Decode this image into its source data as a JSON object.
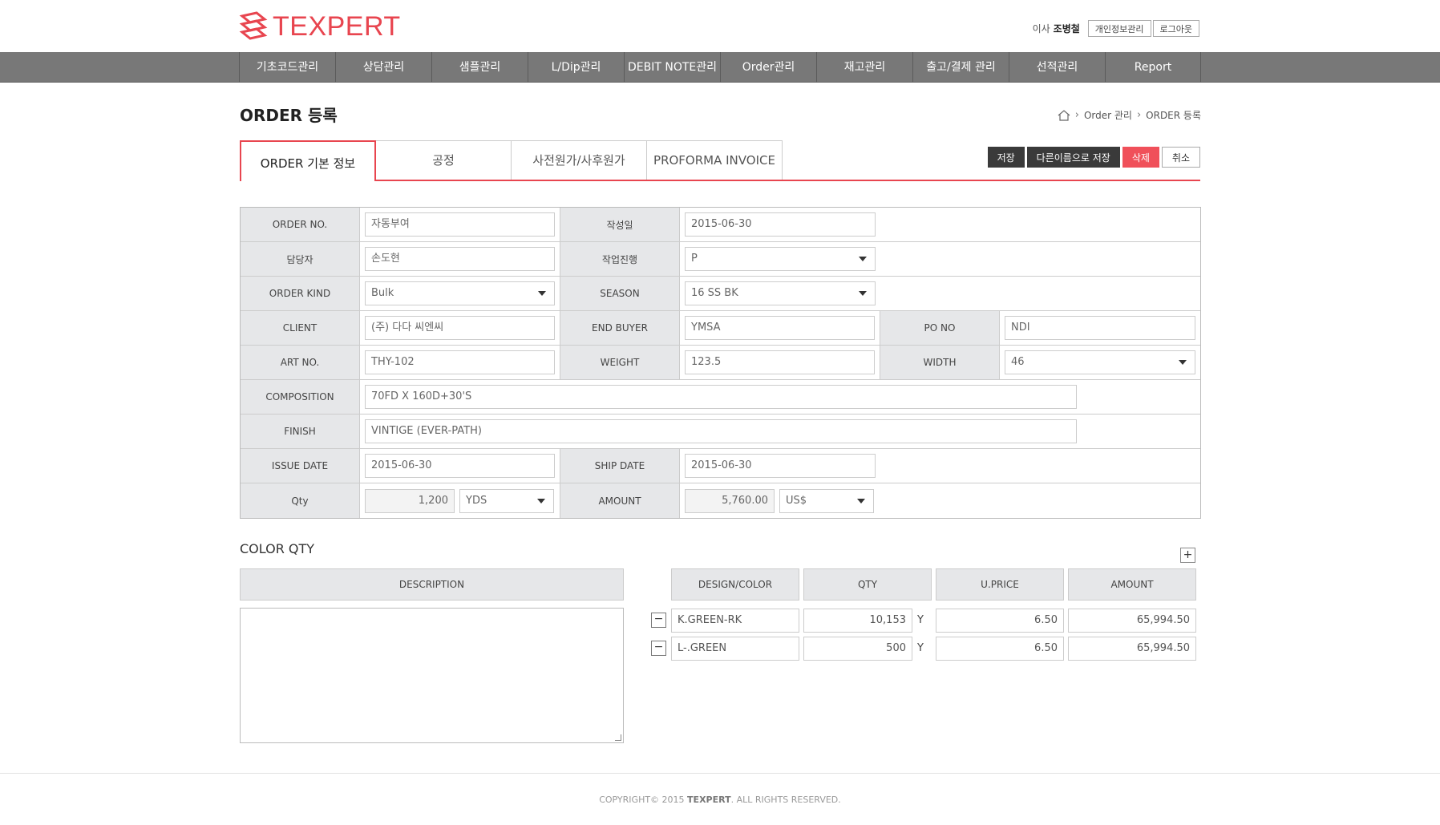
{
  "header": {
    "logo_text": "TEXPERT",
    "user_title": "이사",
    "user_name": "조병철",
    "profile_btn": "개인정보관리",
    "logout_btn": "로그아웃"
  },
  "nav": [
    "기초코드관리",
    "상담관리",
    "샘플관리",
    "L/Dip관리",
    "DEBIT NOTE관리",
    "Order관리",
    "재고관리",
    "출고/결제 관리",
    "선적관리",
    "Report"
  ],
  "page": {
    "title": "ORDER 등록",
    "breadcrumb": [
      "Order 관리",
      "ORDER 등록"
    ]
  },
  "tabs": [
    "ORDER 기본 정보",
    "공정",
    "사전원가/사후원가",
    "PROFORMA INVOICE"
  ],
  "actions": {
    "save": "저장",
    "save_as": "다른이름으로 저장",
    "delete": "삭제",
    "cancel": "취소"
  },
  "form": {
    "order_no_label": "ORDER NO.",
    "order_no": "자동부여",
    "created_label": "작성일",
    "created": "2015-06-30",
    "manager_label": "담당자",
    "manager": "손도현",
    "progress_label": "작업진행",
    "progress": "P",
    "kind_label": "ORDER KIND",
    "kind": "Bulk",
    "season_label": "SEASON",
    "season": "16 SS BK",
    "client_label": "CLIENT",
    "client": "(주) 다다 씨엔씨",
    "end_buyer_label": "END BUYER",
    "end_buyer": "YMSA",
    "po_label": "PO NO",
    "po": "NDI",
    "art_label": "ART NO.",
    "art": "THY-102",
    "weight_label": "WEIGHT",
    "weight": "123.5",
    "width_label": "WIDTH",
    "width": "46",
    "composition_label": "COMPOSITION",
    "composition": "70FD X 160D+30'S",
    "finish_label": "FINISH",
    "finish": "VINTIGE (EVER-PATH)",
    "issue_label": "ISSUE DATE",
    "issue": "2015-06-30",
    "ship_label": "SHIP DATE",
    "ship": "2015-06-30",
    "qty_label": "Qty",
    "qty": "1,200",
    "qty_unit": "YDS",
    "amount_label": "AMOUNT",
    "amount": "5,760.00",
    "currency": "US$"
  },
  "color_qty": {
    "title": "COLOR QTY",
    "desc_header": "DESCRIPTION",
    "headers": [
      "DESIGN/COLOR",
      "QTY",
      "U.PRICE",
      "AMOUNT"
    ],
    "rows": [
      {
        "color": "K.GREEN-RK",
        "qty": "10,153",
        "unit": "Y",
        "price": "6.50",
        "amount": "65,994.50"
      },
      {
        "color": "L-.GREEN",
        "qty": "500",
        "unit": "Y",
        "price": "6.50",
        "amount": "65,994.50"
      }
    ]
  },
  "footer": {
    "copy_prefix": "COPYRIGHT© 2015",
    "copy_brand": "TEXPERT",
    "copy_suffix": ". ALL RIGHTS RESERVED."
  }
}
